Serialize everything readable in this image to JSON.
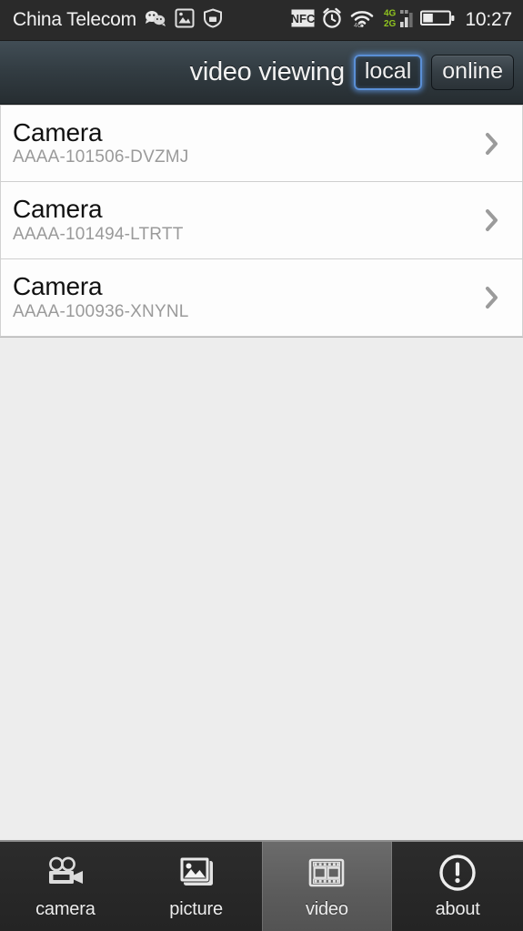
{
  "status_bar": {
    "carrier": "China Telecom",
    "clock": "10:27",
    "left_icons": [
      "wechat-icon",
      "screenshot-icon",
      "shield-location-icon"
    ],
    "right_icons": [
      "nfc-icon",
      "alarm-clock-icon",
      "wifi-icon",
      "signal-4g-2g-icon",
      "battery-icon"
    ],
    "network_4g_label": "4G",
    "network_2g_label": "2G",
    "nfc_label": "NFC",
    "background_color": "#2a2a2a"
  },
  "title_bar": {
    "title": "video viewing",
    "buttons": [
      {
        "label": "local",
        "selected": true
      },
      {
        "label": "online",
        "selected": false
      }
    ],
    "selected_outline_color": "#5a8fd6"
  },
  "camera_list": {
    "items": [
      {
        "name": "Camera",
        "uid": "AAAA-101506-DVZMJ",
        "chevron": "chevron-right-icon"
      },
      {
        "name": "Camera",
        "uid": "AAAA-101494-LTRTT",
        "chevron": "chevron-right-icon"
      },
      {
        "name": "Camera",
        "uid": "AAAA-100936-XNYNL",
        "chevron": "chevron-right-icon"
      }
    ]
  },
  "tab_bar": {
    "tabs": [
      {
        "label": "camera",
        "icon": "movie-camera-icon",
        "active": false
      },
      {
        "label": "picture",
        "icon": "photos-stack-icon",
        "active": false
      },
      {
        "label": "video",
        "icon": "film-strip-icon",
        "active": true
      },
      {
        "label": "about",
        "icon": "exclamation-circle-icon",
        "active": false
      }
    ]
  },
  "colors": {
    "page_background": "#ededed",
    "card_background": "#fdfdfd",
    "title_text": "#f3f3f3",
    "subtitle_text": "#9a9a9a",
    "accent": "#5a8fd6"
  }
}
